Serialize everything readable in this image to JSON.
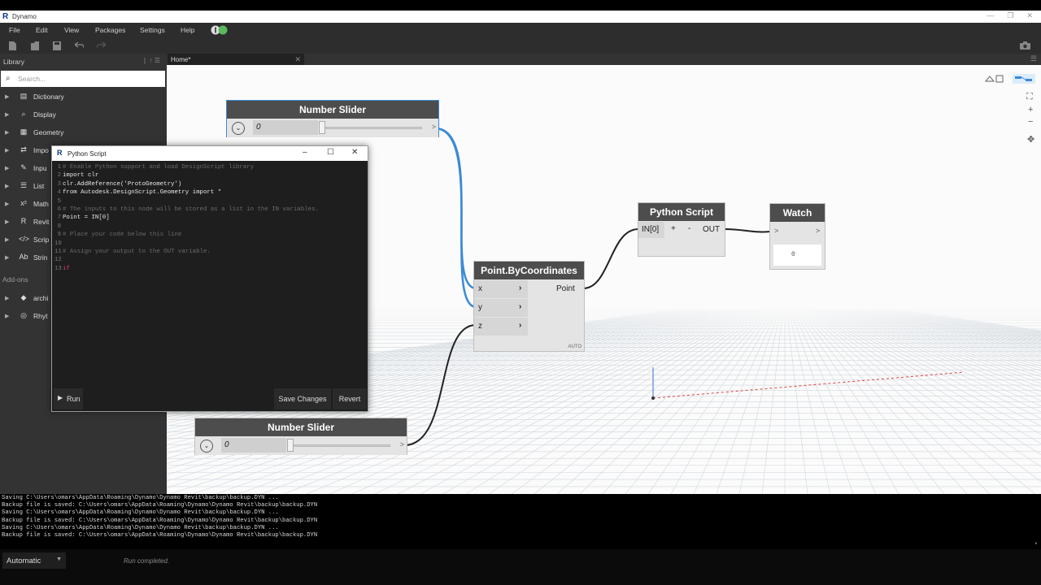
{
  "window": {
    "title": "Dynamo",
    "logo": "R",
    "buttons": [
      "—",
      "❐",
      "✕"
    ]
  },
  "menu": [
    "File",
    "Edit",
    "View",
    "Packages",
    "Settings",
    "Help"
  ],
  "library": {
    "title": "Library",
    "search_placeholder": "Search...",
    "categories": [
      {
        "icon": "▤",
        "label": "Dictionary"
      },
      {
        "icon": "⌕",
        "label": "Display"
      },
      {
        "icon": "▦",
        "label": "Geometry"
      },
      {
        "icon": "⇄",
        "label": "Impo"
      },
      {
        "icon": "✎",
        "label": "Inpu"
      },
      {
        "icon": "☰",
        "label": "List"
      },
      {
        "icon": "x²",
        "label": "Math"
      },
      {
        "icon": "R",
        "label": "Revit"
      },
      {
        "icon": "</>",
        "label": "Scrip"
      },
      {
        "icon": "Ab",
        "label": "Strin"
      }
    ],
    "addons_label": "Add-ons",
    "addons": [
      {
        "icon": "◆",
        "label": "archi"
      },
      {
        "icon": "◎",
        "label": "Rhyt"
      }
    ]
  },
  "tab": {
    "label": "Home*",
    "close": "✕"
  },
  "nodes": {
    "slider1": {
      "title": "Number Slider",
      "value": "0",
      "out": ">"
    },
    "slider2": {
      "title": "Number Slider",
      "value": "0",
      "out": ">"
    },
    "point": {
      "title": "Point.ByCoordinates",
      "inputs": [
        "x",
        "y",
        "z"
      ],
      "output": "Point",
      "lacing": "AUTO"
    },
    "python": {
      "title": "Python Script",
      "input": "IN[0]",
      "plus": "+",
      "minus": "-",
      "output": "OUT"
    },
    "watch": {
      "title": "Watch",
      "in": ">",
      "out": ">",
      "value": "0"
    }
  },
  "editor": {
    "title": "Python Script",
    "run": "Run",
    "save": "Save Changes",
    "revert": "Revert",
    "lines": [
      {
        "n": "1",
        "t": "# Enable Python support and load DesignScript library",
        "cls": "c-cm"
      },
      {
        "n": "2",
        "t": "import clr",
        "cls": ""
      },
      {
        "n": "3",
        "t": "clr.AddReference('ProtoGeometry')",
        "cls": ""
      },
      {
        "n": "4",
        "t": "from Autodesk.DesignScript.Geometry import *",
        "cls": ""
      },
      {
        "n": "5",
        "t": "",
        "cls": ""
      },
      {
        "n": "6",
        "t": "# The inputs to this node will be stored as a list in the IN variables.",
        "cls": "c-cm"
      },
      {
        "n": "7",
        "t": "Point = IN[0]",
        "cls": ""
      },
      {
        "n": "8",
        "t": "",
        "cls": ""
      },
      {
        "n": "9",
        "t": "# Place your code below this line",
        "cls": "c-cm"
      },
      {
        "n": "10",
        "t": "",
        "cls": ""
      },
      {
        "n": "11",
        "t": "# Assign your output to the OUT variable.",
        "cls": "c-cm"
      },
      {
        "n": "12",
        "t": "",
        "cls": ""
      },
      {
        "n": "13",
        "t": "if",
        "cls": "c-kw"
      }
    ]
  },
  "console": [
    "Saving C:\\Users\\omars\\AppData\\Roaming\\Dynamo\\Dynamo Revit\\backup\\backup.DYN ...",
    "Backup file is saved: C:\\Users\\omars\\AppData\\Roaming\\Dynamo\\Dynamo Revit\\backup\\backup.DYN",
    "Saving C:\\Users\\omars\\AppData\\Roaming\\Dynamo\\Dynamo Revit\\backup\\backup.DYN ...",
    "Backup file is saved: C:\\Users\\omars\\AppData\\Roaming\\Dynamo\\Dynamo Revit\\backup\\backup.DYN",
    "Saving C:\\Users\\omars\\AppData\\Roaming\\Dynamo\\Dynamo Revit\\backup\\backup.DYN ...",
    "Backup file is saved: C:\\Users\\omars\\AppData\\Roaming\\Dynamo\\Dynamo Revit\\backup\\backup.DYN"
  ],
  "status": {
    "run_mode": "Automatic",
    "run_status": "Run completed."
  },
  "colors": {
    "wire_selected": "#3a8ad6",
    "wire": "#222222",
    "node_header": "#4d4d4d",
    "keyword": "#d23a7a"
  }
}
